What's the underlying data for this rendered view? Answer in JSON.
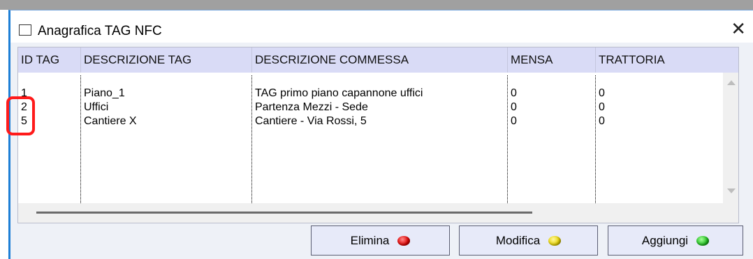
{
  "window": {
    "title": "Anagrafica TAG NFC",
    "close_glyph": "✕"
  },
  "table": {
    "columns": [
      "ID TAG",
      "DESCRIZIONE TAG",
      "DESCRIZIONE COMMESSA",
      "MENSA",
      "TRATTORIA"
    ],
    "rows": [
      [
        "1",
        "Piano_1",
        "TAG primo piano capannone uffici",
        "0",
        "0"
      ],
      [
        "2",
        "Uffici",
        "Partenza Mezzi - Sede",
        "0",
        "0"
      ],
      [
        "5",
        "Cantiere X",
        "Cantiere - Via Rossi, 5",
        "0",
        "0"
      ]
    ]
  },
  "buttons": {
    "delete_label": "Elimina",
    "edit_label": "Modifica",
    "add_label": "Aggiungi"
  },
  "indicators": {
    "delete_led_color": "#e00000",
    "edit_led_color": "#e8d400",
    "add_led_color": "#1fbf1f",
    "highlight_color": "#ff1a1a"
  },
  "icons": {
    "window_icon": "window-icon",
    "close_icon": "close-icon",
    "scroll_up_icon": "scroll-up-arrow-icon",
    "scroll_down_icon": "scroll-down-arrow-icon"
  }
}
